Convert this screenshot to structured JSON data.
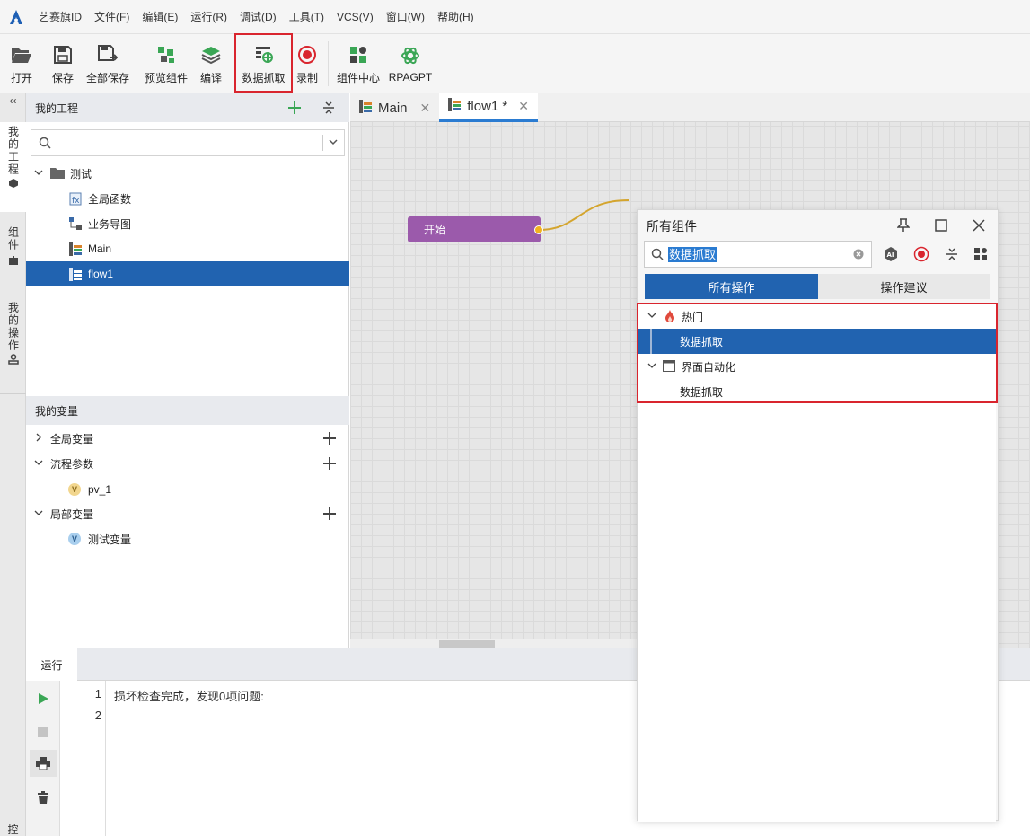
{
  "menubar": {
    "items": [
      "艺赛旗ID",
      "文件(F)",
      "编辑(E)",
      "运行(R)",
      "调试(D)",
      "工具(T)",
      "VCS(V)",
      "窗口(W)",
      "帮助(H)"
    ]
  },
  "toolbar": {
    "open": "打开",
    "save": "保存",
    "save_all": "全部保存",
    "preview": "预览组件",
    "compile": "编译",
    "data_scrape": "数据抓取",
    "record": "录制",
    "component_center": "组件中心",
    "rpagpt": "RPAGPT"
  },
  "vtabs": {
    "project": "我的工程",
    "components": "组件",
    "operations": "我的操作",
    "bottom": "控"
  },
  "project_panel": {
    "title": "我的工程",
    "folder": "测试",
    "items": [
      "全局函数",
      "业务导图",
      "Main",
      "flow1"
    ]
  },
  "variables_panel": {
    "title": "我的变量",
    "groups": [
      "全局变量",
      "流程参数",
      "局部变量"
    ],
    "flow_params": [
      "pv_1"
    ],
    "local_vars": [
      "测试变量"
    ],
    "badge": "V"
  },
  "editor_tabs": [
    {
      "label": "Main"
    },
    {
      "label": "flow1 *"
    }
  ],
  "canvas": {
    "start_node": "开始"
  },
  "bottom_panel": {
    "tab": "运行",
    "lines": [
      {
        "no": "1",
        "text": "损坏检查完成，发现0项问题:"
      },
      {
        "no": "2",
        "text": ""
      }
    ]
  },
  "components_panel": {
    "title": "所有组件",
    "search_value": "数据抓取",
    "tab_all": "所有操作",
    "tab_suggest": "操作建议",
    "hot_group": "热门",
    "hot_item": "数据抓取",
    "ui_group": "界面自动化",
    "ui_item": "数据抓取"
  },
  "colors": {
    "accent": "#2163b0",
    "highlight_red": "#d9252e",
    "start_node": "#9b5aab",
    "green_icon": "#3aa655"
  }
}
